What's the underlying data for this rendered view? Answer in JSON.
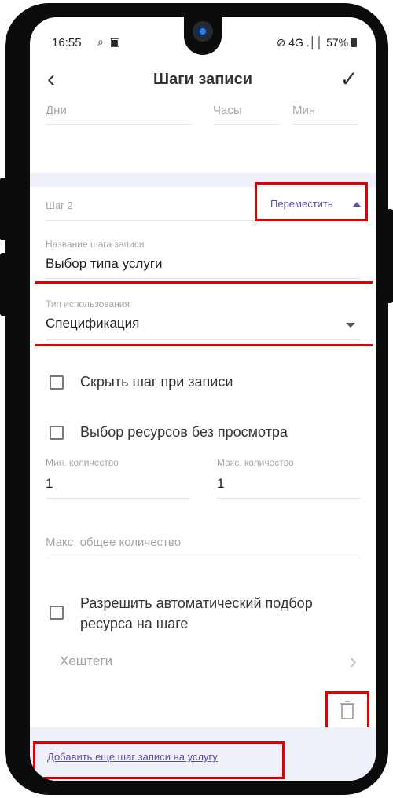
{
  "status_bar": {
    "time": "16:55",
    "left_icons": "⌕ ▣",
    "right_icons": "⊘ 4G .││",
    "battery": "57%"
  },
  "app_bar": {
    "back_icon": "‹",
    "title": "Шаги записи",
    "confirm_icon": "✓"
  },
  "duration": {
    "days_placeholder": "Дни",
    "hours_placeholder": "Часы",
    "minutes_placeholder": "Мин"
  },
  "step": {
    "label": "Шаг 2",
    "move_label": "Переместить",
    "name_label": "Название шага записи",
    "name_value": "Выбор типа услуги",
    "usage_label": "Тип использования",
    "usage_value": "Спецификация",
    "hide_step_label": "Скрыть шаг при записи",
    "resource_choice_label": "Выбор ресурсов без просмотра",
    "min_qty_label": "Мин. количество",
    "min_qty_value": "1",
    "max_qty_label": "Макс. количество",
    "max_qty_value": "1",
    "max_total_placeholder": "Макс. общее количество",
    "auto_select_label_line1": "Разрешить автоматический подбор",
    "auto_select_label_line2": "ресурса на шаге",
    "hashtags_label": "Хештеги",
    "hashtags_chevron": "›"
  },
  "footer": {
    "add_step_label": "Добавить еще шаг записи на услугу"
  },
  "colors": {
    "highlight": "#e00000",
    "accent": "#5b4ea8",
    "section_bg": "#eef1fa"
  }
}
